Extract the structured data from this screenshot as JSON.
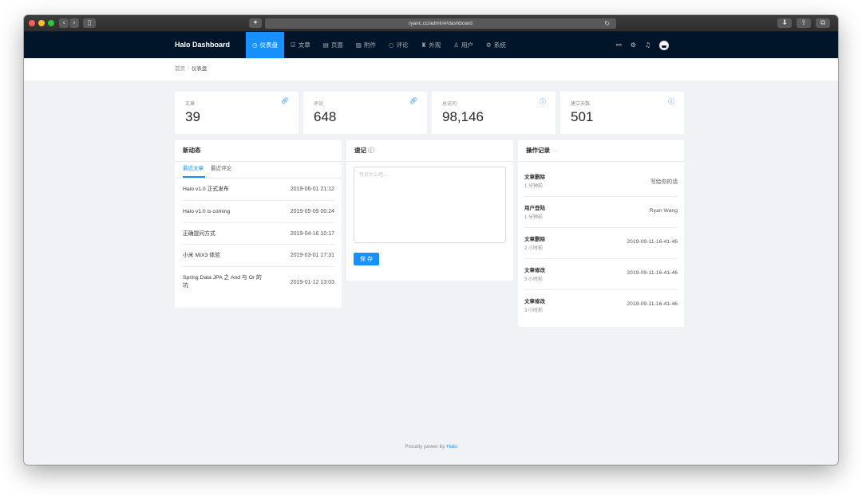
{
  "browser": {
    "url": "ryanc.cc/admin#/dashboard"
  },
  "header": {
    "logo": "Halo Dashboard",
    "nav": [
      {
        "label": "仪表盘",
        "icon": "dashboard-icon",
        "active": true
      },
      {
        "label": "文章",
        "icon": "form-icon",
        "active": false
      },
      {
        "label": "页面",
        "icon": "read-icon",
        "active": false
      },
      {
        "label": "附件",
        "icon": "picture-icon",
        "active": false
      },
      {
        "label": "评论",
        "icon": "message-icon",
        "active": false
      },
      {
        "label": "外观",
        "icon": "skin-icon",
        "active": false
      },
      {
        "label": "用户",
        "icon": "user-icon",
        "active": false
      },
      {
        "label": "系统",
        "icon": "setting-icon",
        "active": false
      }
    ],
    "right_icons": [
      "link-icon",
      "setting-icon",
      "bell-icon",
      "avatar"
    ]
  },
  "breadcrumb": [
    "首页",
    "仪表盘"
  ],
  "stats": [
    {
      "label": "文章",
      "value": "39",
      "icon": "link-icon"
    },
    {
      "label": "评论",
      "value": "648",
      "icon": "link-icon"
    },
    {
      "label": "总访问",
      "value": "98,146",
      "icon": "info-circle-icon"
    },
    {
      "label": "建立天数",
      "value": "501",
      "icon": "info-circle-icon"
    }
  ],
  "activity": {
    "title": "新动态",
    "tabs": [
      "最近文章",
      "最近评论"
    ],
    "active_tab": "最近文章",
    "posts": [
      {
        "title": "Halo v1.0 正式发布",
        "date": "2019-06-01 21:12"
      },
      {
        "title": "Halo v1.0 is coming",
        "date": "2019-05-09 00:24"
      },
      {
        "title": "正确提问方式",
        "date": "2019-04-16 10:17"
      },
      {
        "title": "小米 MIX3 体验",
        "date": "2019-03-01 17:31"
      },
      {
        "title": "Spring Data JPA 之 And 与 Or 的坑",
        "date": "2019-01-12 13:03"
      }
    ]
  },
  "notes": {
    "title": "速记",
    "placeholder": "写点什么吧...",
    "save_label": "保 存"
  },
  "logs": {
    "title": "操作记录",
    "more": "···",
    "items": [
      {
        "type": "文章删除",
        "time": "1 分钟前",
        "content": "写给你的话"
      },
      {
        "type": "用户登陆",
        "time": "1 分钟前",
        "content": "Ryan Wang"
      },
      {
        "type": "文章删除",
        "time": "2 小时前",
        "content": "2019-09-11-16-41-46"
      },
      {
        "type": "文章修改",
        "time": "3 小时前",
        "content": "2019-09-11-16-41-46"
      },
      {
        "type": "文章修改",
        "time": "3 小时前",
        "content": "2019-09-11-16-41-46"
      }
    ]
  },
  "footer": {
    "text": "Proudly power by ",
    "link": "Halo"
  }
}
